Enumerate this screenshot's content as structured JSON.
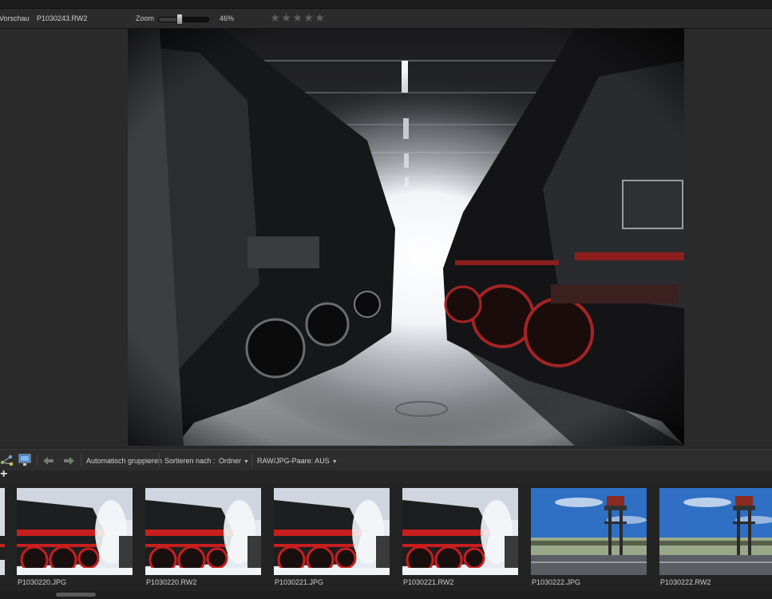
{
  "header": {
    "title": "Vorschau",
    "filename": "P1030243.RW2",
    "zoom_label": "Zoom",
    "zoom_value": "46%",
    "zoom_level": 0.46,
    "rating": {
      "max": 5,
      "value": 0,
      "glyph": "★"
    }
  },
  "toolbar": {
    "auto_group": "Automatisch gruppieren",
    "sort_label": "Sortieren nach :",
    "sort_value": "Ordner",
    "raw_jpg_pairs": "RAW/JPG-Paare: AUS",
    "add_symbol": "+"
  },
  "filmstrip": {
    "items": [
      {
        "label": "P1030220.JPG",
        "kind": "train"
      },
      {
        "label": "P1030220.RW2",
        "kind": "train"
      },
      {
        "label": "P1030221.JPG",
        "kind": "train"
      },
      {
        "label": "P1030221.RW2",
        "kind": "train"
      },
      {
        "label": "P1030222.JPG",
        "kind": "tower"
      },
      {
        "label": "P1030222.RW2",
        "kind": "tower"
      }
    ]
  },
  "colors": {
    "panel": "#2b2b2b",
    "loco_red": "#c81e1e",
    "sky_blue": "#2f6fc4",
    "text": "#cfcfcf"
  }
}
